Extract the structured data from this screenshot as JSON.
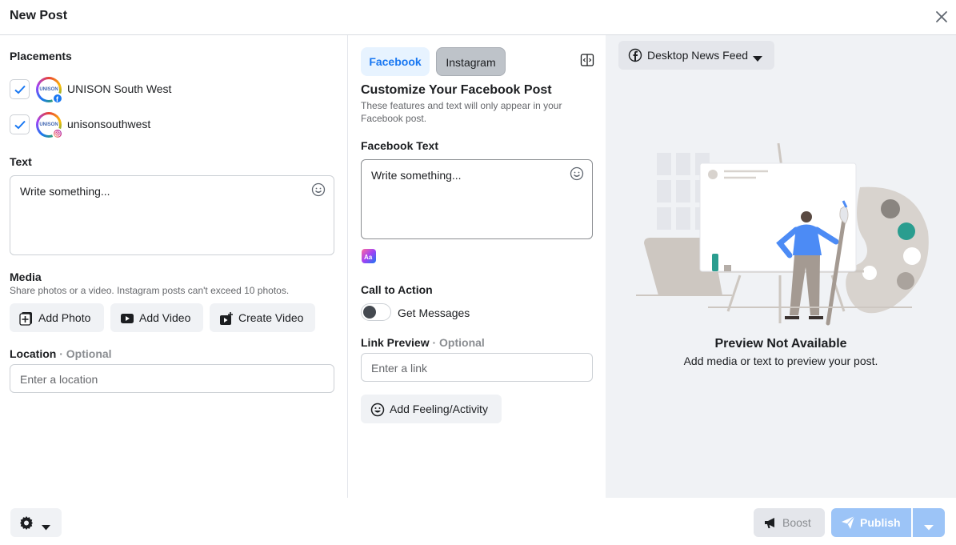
{
  "header": {
    "title": "New Post"
  },
  "left": {
    "placements_title": "Placements",
    "placements": [
      {
        "name": "UNISON South West",
        "checked": true,
        "network": "facebook"
      },
      {
        "name": "unisonsouthwest",
        "checked": true,
        "network": "instagram"
      }
    ],
    "avatar_text": "UNISON",
    "text_title": "Text",
    "text_placeholder": "Write something...",
    "media_title": "Media",
    "media_sub": "Share photos or a video. Instagram posts can't exceed 10 photos.",
    "media_buttons": {
      "add_photo": "Add Photo",
      "add_video": "Add Video",
      "create_video": "Create Video"
    },
    "location_title": "Location",
    "location_optional": "· Optional",
    "location_placeholder": "Enter a location"
  },
  "middle": {
    "tabs": {
      "facebook": "Facebook",
      "instagram": "Instagram"
    },
    "customize_title": "Customize Your Facebook Post",
    "customize_sub": "These features and text will only appear in your Facebook post.",
    "fb_text_title": "Facebook Text",
    "fb_text_placeholder": "Write something...",
    "cta_title": "Call to Action",
    "cta_toggle_label": "Get Messages",
    "cta_enabled": false,
    "link_title": "Link Preview",
    "link_optional": "· Optional",
    "link_placeholder": "Enter a link",
    "feeling_button": "Add Feeling/Activity"
  },
  "right": {
    "feed_select": "Desktop News Feed",
    "preview_title": "Preview Not Available",
    "preview_sub": "Add media or text to preview your post."
  },
  "footer": {
    "boost_label": "Boost",
    "publish_label": "Publish"
  },
  "colors": {
    "accent": "#1877f2",
    "publish_disabled": "#9cc4f7",
    "preview_bg": "#f0f2f5",
    "illustration_teal": "#2a9d8f"
  }
}
